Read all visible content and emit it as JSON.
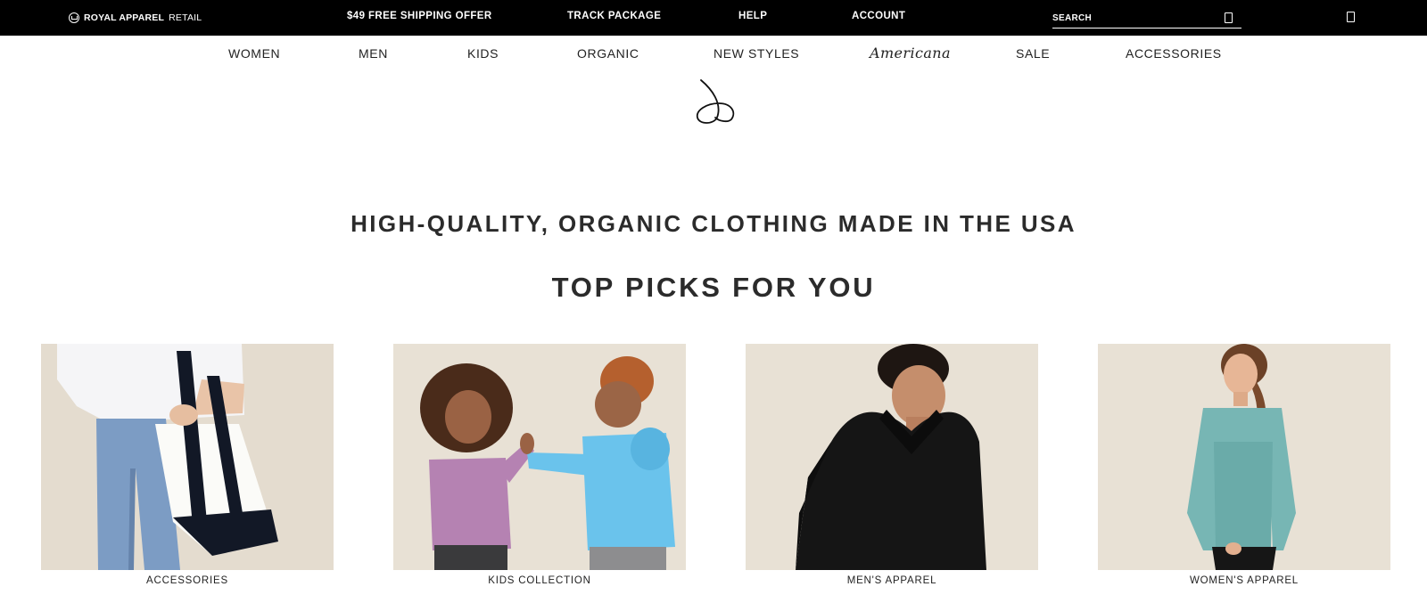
{
  "topbar": {
    "brand_bold": "ROYAL APPAREL",
    "brand_rest": "RETAIL",
    "links": {
      "shipping": "$49 FREE SHIPPING OFFER",
      "track": "TRACK PACKAGE",
      "help": "HELP",
      "account": "ACCOUNT"
    },
    "search_placeholder": "SEARCH",
    "icons": {
      "logo": "crown-logo-icon",
      "search": "search-icon",
      "cart": "cart-icon"
    }
  },
  "nav": {
    "women": "WOMEN",
    "men": "MEN",
    "kids": "KIDS",
    "organic": "ORGANIC",
    "new_styles": "NEW STYLES",
    "americana": "Americana",
    "sale": "SALE",
    "accessories": "ACCESSORIES"
  },
  "decor": {
    "icon": "swirl-logo-icon"
  },
  "main": {
    "tagline": "HIGH-QUALITY, ORGANIC CLOTHING MADE IN THE USA",
    "section_title": "TOP PICKS FOR YOU",
    "tiles": [
      {
        "label": "ACCESSORIES"
      },
      {
        "label": "KIDS COLLECTION"
      },
      {
        "label": "MEN'S APPAREL"
      },
      {
        "label": "WOMEN'S APPAREL"
      }
    ]
  },
  "colors": {
    "topbar_bg": "#000000",
    "text": "#222222",
    "photo_wall": "#e7e0d4"
  }
}
